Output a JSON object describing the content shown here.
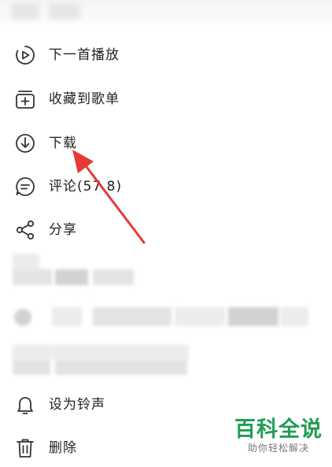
{
  "menu": {
    "items": [
      {
        "label": "下一首播放",
        "icon": "play-next-icon"
      },
      {
        "label": "收藏到歌单",
        "icon": "add-to-playlist-icon"
      },
      {
        "label": "下载",
        "icon": "download-icon"
      },
      {
        "label": "评论(57 8)",
        "icon": "comment-icon"
      },
      {
        "label": "分享",
        "icon": "share-icon"
      }
    ],
    "bottom_items": [
      {
        "label": "设为铃声",
        "icon": "bell-icon"
      },
      {
        "label": "删除",
        "icon": "trash-icon"
      }
    ]
  },
  "annotation": {
    "type": "arrow",
    "color": "#e53935",
    "target": "download"
  },
  "watermark": {
    "title": "百科全说",
    "subtitle": "助你轻松解决",
    "color": "#1e9e54"
  }
}
